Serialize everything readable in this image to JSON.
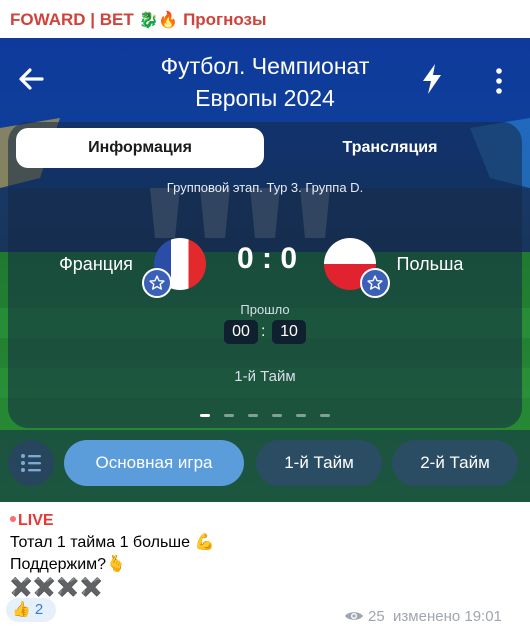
{
  "channel": {
    "name": "FOWARD | BET",
    "emoji_dragon": "🐉",
    "emoji_fire": "🔥",
    "tag": "Прогнозы"
  },
  "app": {
    "title_line1": "Футбол. Чемпионат",
    "title_line2": "Европы 2024",
    "tabs": {
      "info": "Информация",
      "stream": "Трансляция"
    },
    "stage": "Групповой этап. Тур 3. Группа D.",
    "team_home": "Франция",
    "team_away": "Польша",
    "score": "0 : 0",
    "elapsed_label": "Прошло",
    "timer_min": "00",
    "timer_sep": ":",
    "timer_sec": "10",
    "period": "1-й Тайм",
    "filters": {
      "main": "Основная игра",
      "half1": "1-й Тайм",
      "half2": "2-й Тайм"
    },
    "pagination": {
      "current": 1,
      "total": 6
    }
  },
  "post": {
    "live": "LIVE",
    "line1": "Тотал 1 тайма 1 больше",
    "line1_emoji": "💪",
    "line2": "Поддержим?",
    "line2_emoji": "🫰",
    "crosses": "✖️✖️✖️✖️",
    "reaction_emoji": "👍",
    "reaction_count": "2",
    "views": "25",
    "edited": "изменено 19:01"
  },
  "colors": {
    "channel": "#d0433a",
    "accent": "#5b9cdb",
    "live": "#e53935"
  },
  "icons": [
    "back-arrow-icon",
    "lightning-icon",
    "more-vertical-icon",
    "star-icon",
    "list-icon",
    "eye-icon"
  ]
}
